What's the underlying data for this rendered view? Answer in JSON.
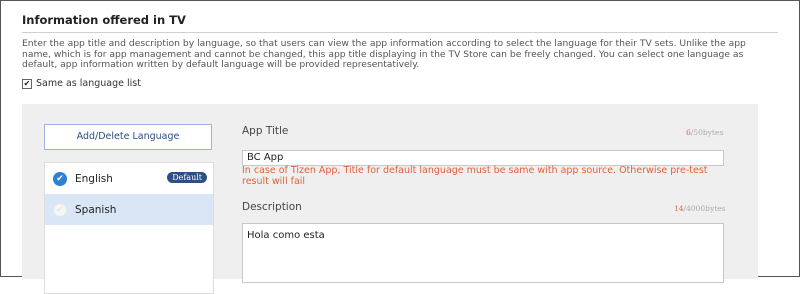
{
  "section": {
    "title": "Information offered in TV",
    "description": "Enter the app title and description by language, so that users can view the app information according to select the language for their TV sets. Unlike the app name, which is for app management and cannot be changed, this app title displaying in the TV Store can be freely changed. You can select one language as default, app information written by default language will be provided representatively."
  },
  "same_as_language": {
    "label": "Same as language list",
    "checked": true
  },
  "language_panel": {
    "add_button_label": "Add/Delete Language",
    "languages": [
      {
        "name": "English",
        "badge": "Default",
        "checked": true,
        "selected": false
      },
      {
        "name": "Spanish",
        "badge": "",
        "checked": false,
        "selected": true
      }
    ]
  },
  "app_title": {
    "label": "App Title",
    "counter_used": "6",
    "counter_limit": "/50bytes",
    "value": "BC App",
    "error": "In case of Tizen App, Title for default language must be same with app source. Otherwise pre-test result will fail"
  },
  "description_field": {
    "label": "Description",
    "counter_used": "14",
    "counter_limit": "/4000bytes",
    "value": "Hola como esta"
  },
  "colors": {
    "accent": "#2f7fd3",
    "badge": "#2e4f82",
    "error": "#e0633a",
    "selected_row": "#d8e6f6"
  }
}
